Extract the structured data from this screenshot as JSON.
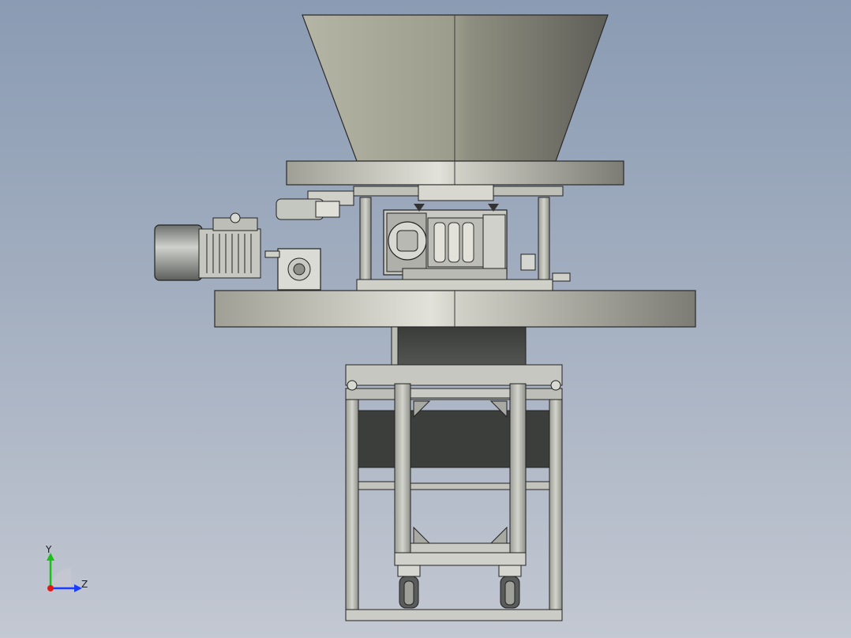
{
  "viewport": {
    "background_top": "#8a9bb3",
    "background_bottom": "#c3c8d2"
  },
  "model": {
    "parts": [
      "hopper-cone",
      "upper-flange-plate",
      "drive-motor",
      "gearbox",
      "worm-gear-reducer",
      "lower-flange-plate",
      "discharge-chute",
      "support-frame",
      "caster-wheel-left",
      "caster-wheel-right"
    ],
    "colors": {
      "steel_light": "#d6d6cc",
      "steel_dark": "#7d7d76",
      "frame_gray": "#b4b6ae",
      "shadow_dark": "#3f413f",
      "outline": "#1f1f1f"
    }
  },
  "triad": {
    "y_label": "Y",
    "z_label": "Z",
    "y_color": "#18c018",
    "z_color": "#1a3cff",
    "x_color": "#e01818"
  }
}
